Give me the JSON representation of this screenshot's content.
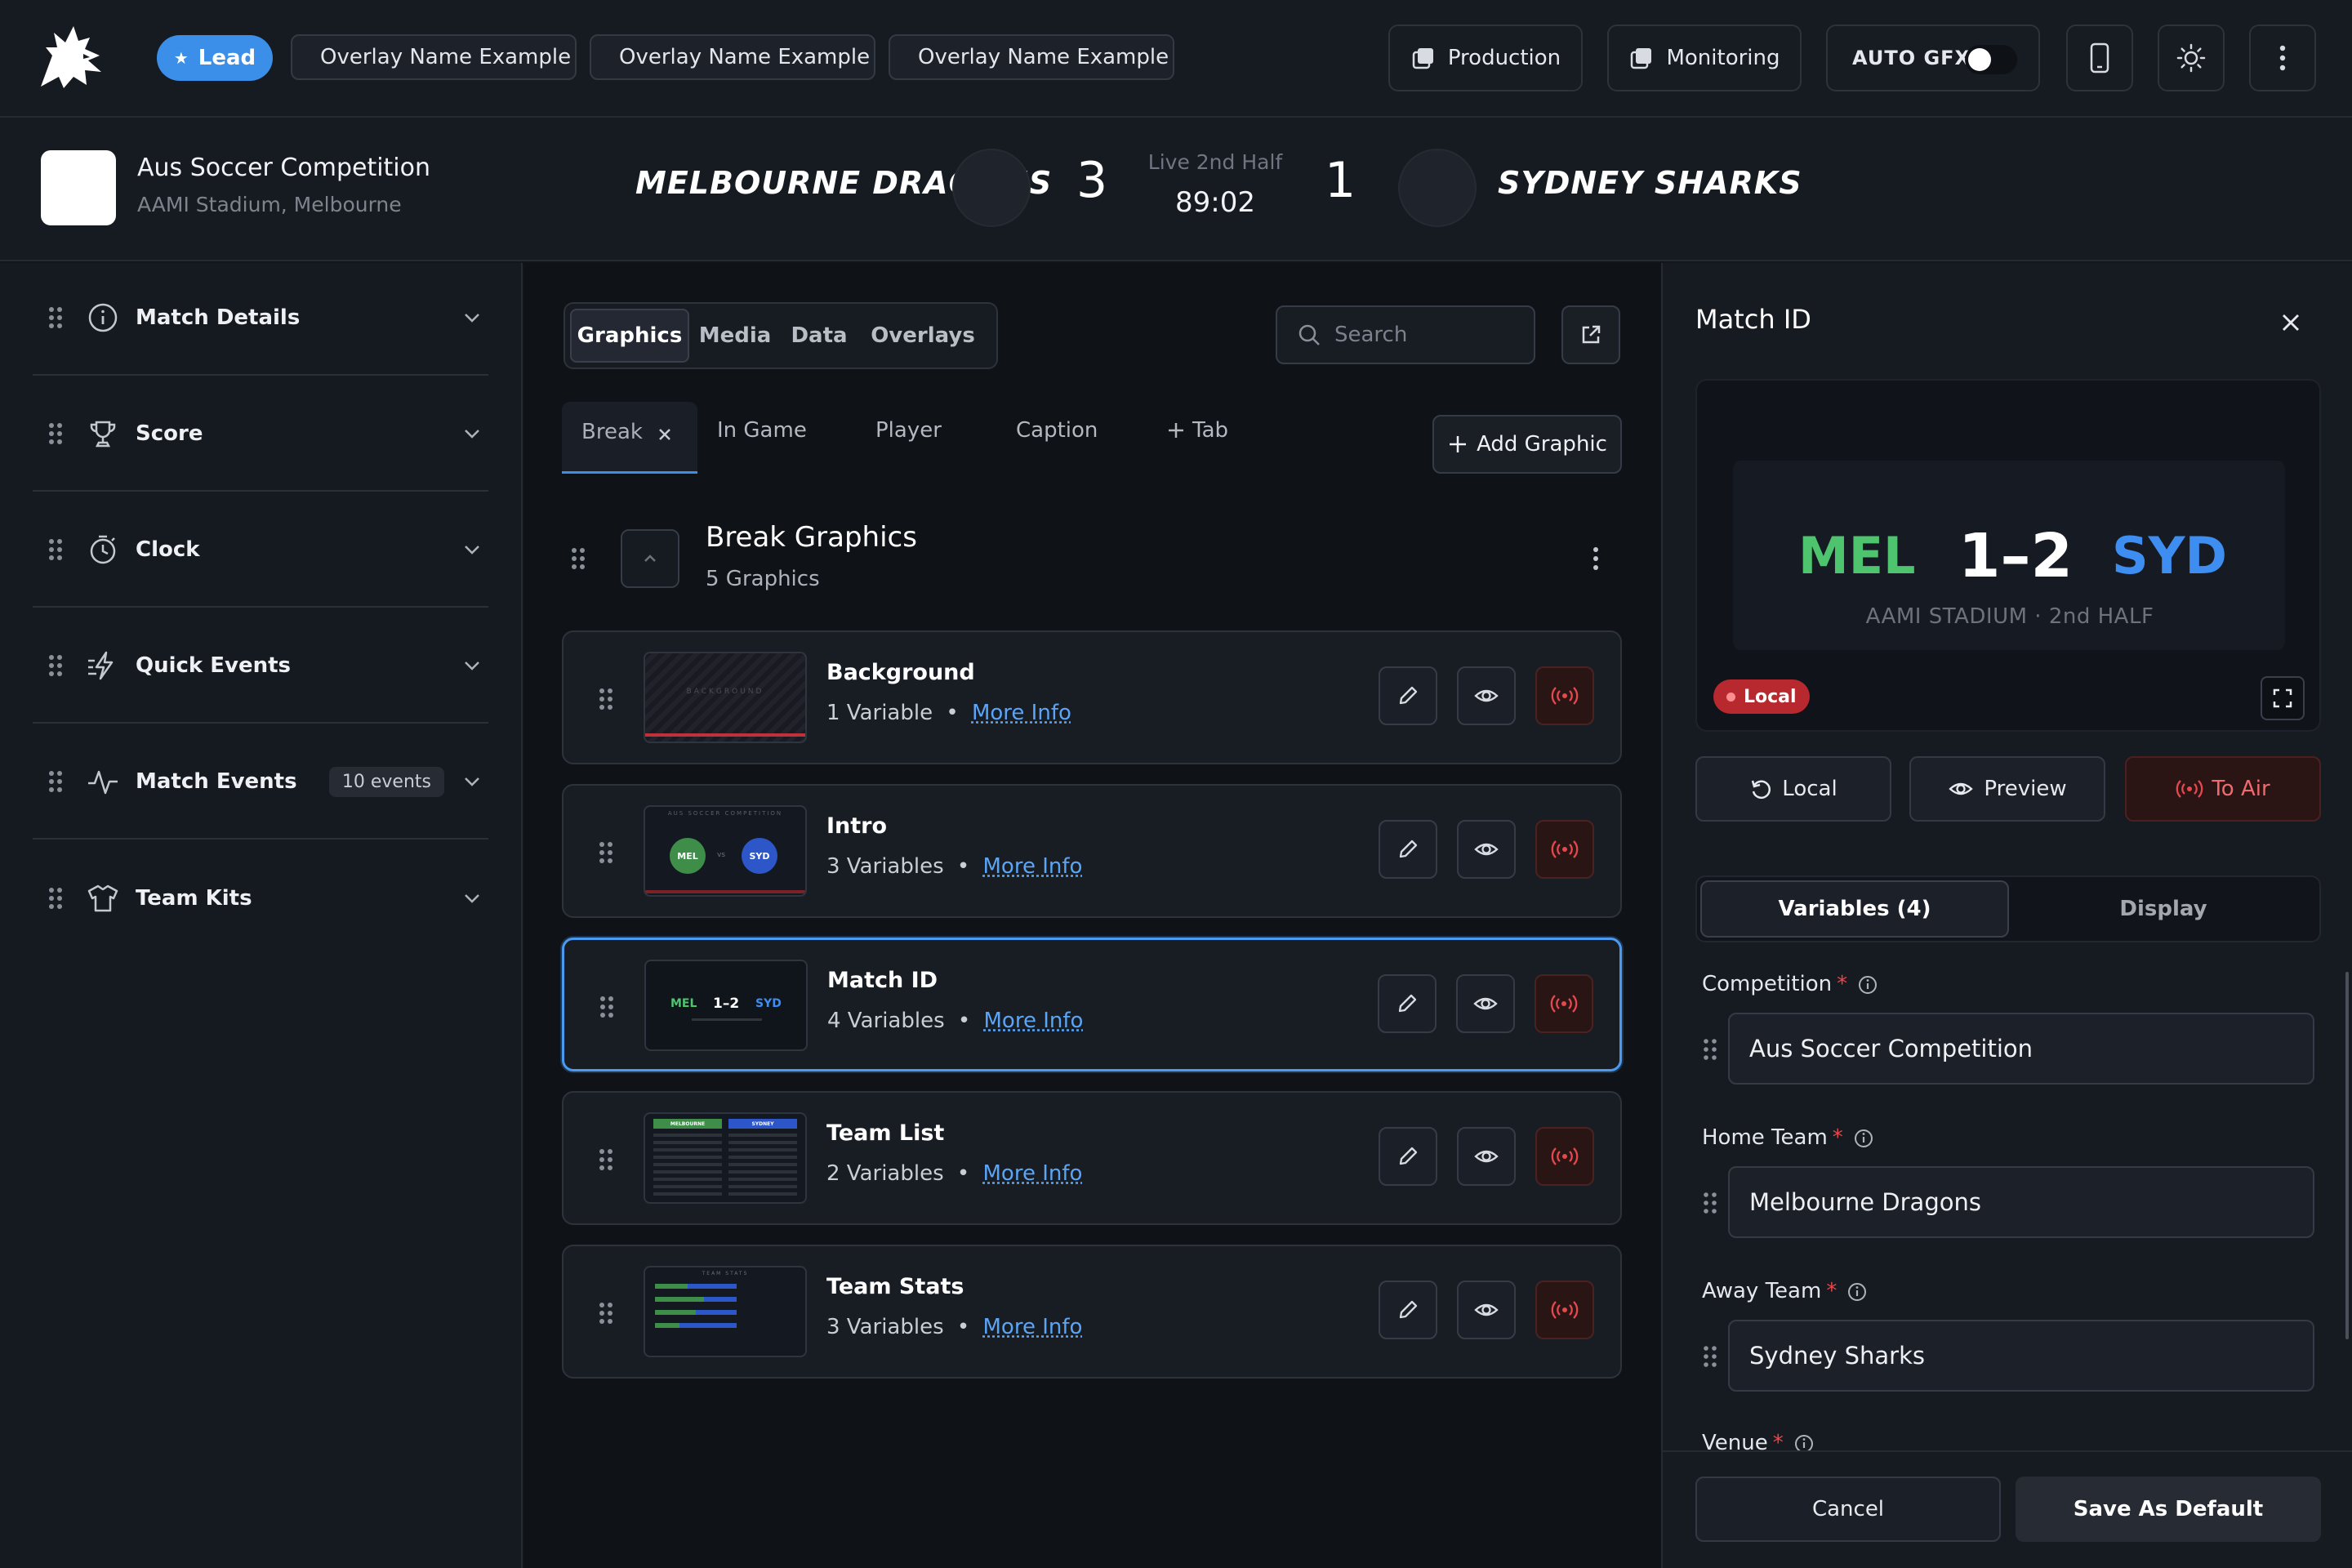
{
  "topbar": {
    "lead_label": "Lead",
    "overlays": [
      "Overlay Name Example",
      "Overlay Name Example",
      "Overlay Name Example"
    ],
    "production_label": "Production",
    "monitoring_label": "Monitoring",
    "auto_gfx_label": "AUTO GFX",
    "auto_gfx_on": true
  },
  "match": {
    "competition": "Aus Soccer Competition",
    "venue": "AAMI Stadium, Melbourne",
    "home_team": "MELBOURNE DRAGONS",
    "away_team": "SYDNEY SHARKS",
    "home_score": "3",
    "away_score": "1",
    "status": "Live 2nd Half",
    "clock": "89:02"
  },
  "sidebar": {
    "items": [
      {
        "label": "Match Details",
        "icon": "info-icon"
      },
      {
        "label": "Score",
        "icon": "trophy-icon"
      },
      {
        "label": "Clock",
        "icon": "stopwatch-icon"
      },
      {
        "label": "Quick Events",
        "icon": "lightning-icon"
      },
      {
        "label": "Match Events",
        "icon": "pulse-icon",
        "count": "10 events"
      },
      {
        "label": "Team Kits",
        "icon": "shirt-icon"
      }
    ]
  },
  "main": {
    "segments": [
      "Graphics",
      "Media",
      "Data",
      "Overlays"
    ],
    "active_segment": "Graphics",
    "search_placeholder": "Search",
    "tabs": [
      "Break",
      "In Game",
      "Player",
      "Caption"
    ],
    "add_tab_label": "Tab",
    "add_graphic_label": "Add Graphic",
    "group_title": "Break Graphics",
    "group_count": "5 Graphics",
    "more_info_label": "More Info",
    "graphics": [
      {
        "title": "Background",
        "variables": "1 Variable"
      },
      {
        "title": "Intro",
        "variables": "3 Variables"
      },
      {
        "title": "Match ID",
        "variables": "4 Variables",
        "selected": true
      },
      {
        "title": "Team List",
        "variables": "2 Variables"
      },
      {
        "title": "Team Stats",
        "variables": "3 Variables"
      }
    ],
    "thumbs": {
      "background_text": "BACKGROUND",
      "intro_header": "AUS SOCCER COMPETITION",
      "intro_home": "MEL",
      "intro_vs": "vs",
      "intro_away": "SYD",
      "matchid_home": "MEL",
      "matchid_score": "1–2",
      "matchid_away": "SYD",
      "teamlist_home": "MELBOURNE",
      "teamlist_away": "SYDNEY",
      "teamstats_header": "TEAM STATS"
    }
  },
  "panel": {
    "title": "Match ID",
    "preview": {
      "home": "MEL",
      "score": "1–2",
      "away": "SYD",
      "subtitle": "AAMI STADIUM · 2nd HALF",
      "badge": "Local"
    },
    "local_label": "Local",
    "preview_label": "Preview",
    "to_air_label": "To Air",
    "tab_variables": "Variables (4)",
    "tab_display": "Display",
    "fields": [
      {
        "label": "Competition",
        "value": "Aus Soccer Competition"
      },
      {
        "label": "Home Team",
        "value": "Melbourne Dragons"
      },
      {
        "label": "Away Team",
        "value": "Sydney Sharks"
      }
    ],
    "venue_label": "Venue",
    "cancel_label": "Cancel",
    "save_label": "Save As Default"
  },
  "colors": {
    "accent": "#3b8fe8",
    "live_green": "#3fb56a",
    "home_green": "#4fc46f",
    "away_blue": "#3d8ef0",
    "air_red": "#e5484d"
  }
}
